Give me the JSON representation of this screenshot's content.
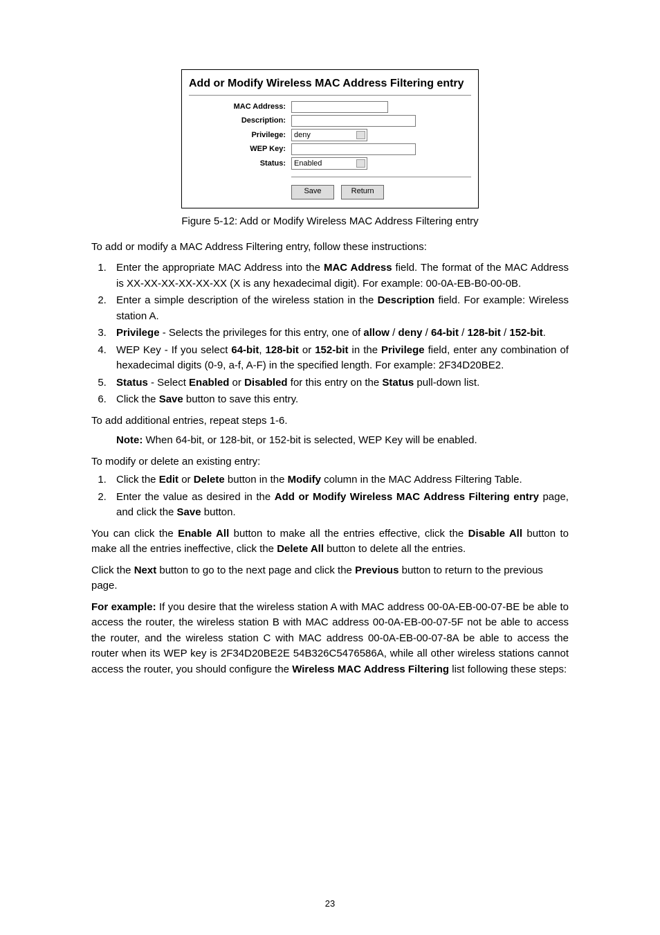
{
  "figure": {
    "box_title": "Add or Modify Wireless MAC Address Filtering entry",
    "labels": {
      "mac": "MAC Address:",
      "desc": "Description:",
      "priv": "Privilege:",
      "wep": "WEP Key:",
      "status": "Status:"
    },
    "values": {
      "priv": "deny",
      "status": "Enabled"
    },
    "buttons": {
      "save": "Save",
      "return": "Return"
    },
    "caption": "Figure 5-12: Add or Modify Wireless MAC Address Filtering entry"
  },
  "intro": "To add or modify a MAC Address Filtering entry, follow these instructions:",
  "steps_main": [
    {
      "pre": "Enter the appropriate MAC Address into the ",
      "b1": "MAC Address",
      "post1": " field. The format of the MAC Address is XX-XX-XX-XX-XX-XX (X is any hexadecimal digit). For example: 00-0A-EB-B0-00-0B."
    },
    {
      "pre": "Enter a simple description of the wireless station in the ",
      "b1": "Description",
      "post1": " field. For example: Wireless station A."
    },
    {
      "b0": "Privilege",
      "t1": " - Selects the privileges for this entry, one of ",
      "b1": "allow",
      "t2": " / ",
      "b2": "deny",
      "t3": " / ",
      "b3": "64-bit",
      "t4": " / ",
      "b4": "128-bit",
      "t5": " / ",
      "b5": "152-bit",
      "t6": "."
    },
    {
      "pre": "WEP Key - If you select ",
      "b1": "64-bit",
      "t1": ", ",
      "b2": "128-bit",
      "t2": " or ",
      "b3": "152-bit",
      "t3": " in the ",
      "b4": "Privilege",
      "t4": " field, enter any combination of hexadecimal digits (0-9, a-f, A-F) in the specified length. For example: 2F34D20BE2."
    },
    {
      "b0": "Status",
      "t1": " - Select ",
      "b1": "Enabled",
      "t2": " or ",
      "b2": "Disabled",
      "t3": " for this entry on the ",
      "b3": "Status",
      "t4": " pull-down list."
    },
    {
      "pre": "Click the ",
      "b1": "Save",
      "post1": " button to save this entry."
    }
  ],
  "add_repeat": "To add additional entries, repeat steps 1-6.",
  "note": {
    "label": "Note:",
    "text": " When 64-bit, or 128-bit, or 152-bit is selected, WEP Key will be enabled."
  },
  "modify_intro": "To modify or delete an existing entry:",
  "steps_modify": [
    {
      "pre": "Click the ",
      "b1": "Edit",
      "t1": " or ",
      "b2": "Delete",
      "t2": " button in the ",
      "b3": "Modify",
      "t3": " column in the MAC Address Filtering Table."
    },
    {
      "pre": "Enter the value as desired in the ",
      "b1": "Add or Modify Wireless MAC Address Filtering entry",
      "t1": " page, and click the ",
      "b2": "Save",
      "t2": " button."
    }
  ],
  "enable_para": {
    "t0": "You can click the ",
    "b0": "Enable All",
    "t1": " button to make all the entries effective, click the ",
    "b1": "Disable All",
    "t2": " button to make all the entries ineffective, click the ",
    "b2": "Delete All",
    "t3": " button to delete all the entries."
  },
  "nav_para": {
    "t0": "Click the ",
    "b0": "Next",
    "t1": " button to go to the next page and click the ",
    "b1": "Previous",
    "t2": " button to return to the previous page."
  },
  "example": {
    "label": "For example:",
    "text": " If you desire that the wireless station A with MAC address 00-0A-EB-00-07-BE be able to access the router, the wireless station B with MAC address 00-0A-EB-00-07-5F not be able to access the router, and the wireless station C with MAC address 00-0A-EB-00-07-8A be able to access the router when its WEP key is 2F34D20BE2E 54B326C5476586A, while all other wireless stations cannot access the router, you should configure the ",
    "bold": "Wireless MAC Address Filtering",
    "tail": " list following these steps:"
  },
  "pagenum": "23"
}
